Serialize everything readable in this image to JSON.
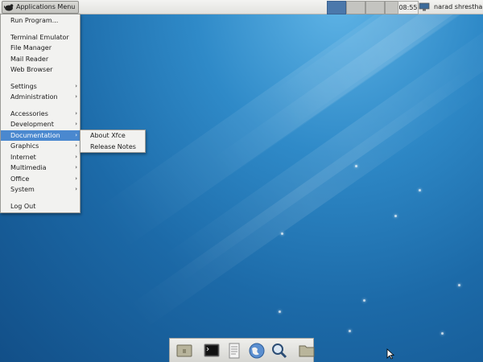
{
  "panel": {
    "apps_menu_label": "Applications Menu",
    "clock": "08:55",
    "user": "narad shrestha",
    "workspaces": [
      {
        "active": true
      },
      {
        "active": false
      },
      {
        "active": false
      },
      {
        "active": false
      }
    ]
  },
  "menu": {
    "run_program": "Run Program...",
    "terminal": "Terminal Emulator",
    "file_manager": "File Manager",
    "mail_reader": "Mail Reader",
    "web_browser": "Web Browser",
    "settings": "Settings",
    "administration": "Administration",
    "accessories": "Accessories",
    "development": "Development",
    "documentation": "Documentation",
    "graphics": "Graphics",
    "internet": "Internet",
    "multimedia": "Multimedia",
    "office": "Office",
    "system": "System",
    "log_out": "Log Out",
    "arrow": "›"
  },
  "submenu": {
    "about_xfce": "About Xfce",
    "release_notes": "Release Notes"
  },
  "dock": {
    "items": [
      "show-desktop",
      "terminal",
      "text-editor",
      "web-browser",
      "app-finder",
      "file-manager"
    ]
  },
  "colors": {
    "selection": "#4a88cf",
    "desktop": "#1c6aa8"
  }
}
